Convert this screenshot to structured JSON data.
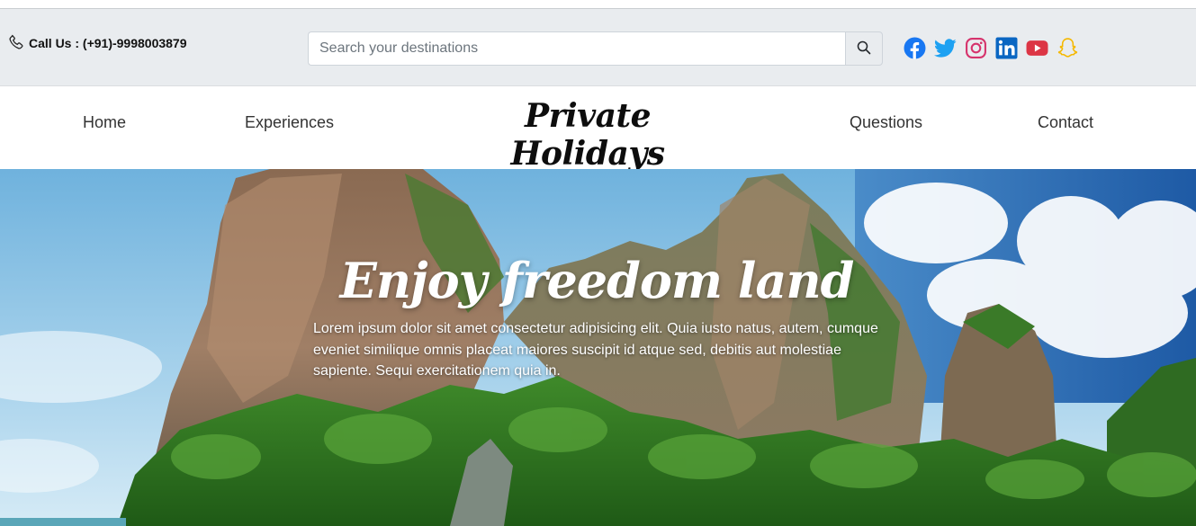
{
  "topbar": {
    "call_label": "Call Us : (+91)-9998003879",
    "search_placeholder": "Search your destinations",
    "socials": [
      "facebook-icon",
      "twitter-icon",
      "instagram-icon",
      "linkedin-icon",
      "youtube-icon",
      "snapchat-icon"
    ]
  },
  "nav": {
    "home": "Home",
    "experiences": "Experiences",
    "brand": "Private Holidays",
    "questions": "Questions",
    "contact": "Contact"
  },
  "hero": {
    "title": "Enjoy freedom land",
    "text": "Lorem ipsum dolor sit amet consectetur adipisicing elit. Quia iusto natus, autem, cumque eveniet similique omnis placeat maiores suscipit id atque sed, debitis aut molestiae sapiente. Sequi exercitationem quia in."
  },
  "colors": {
    "topbar_bg": "#e9ecef",
    "facebook": "#1877f2",
    "twitter": "#1da1f2",
    "instagram": "#d6336c",
    "linkedin": "#0a66c2",
    "youtube": "#dc3545",
    "snapchat": "#f5b800"
  }
}
